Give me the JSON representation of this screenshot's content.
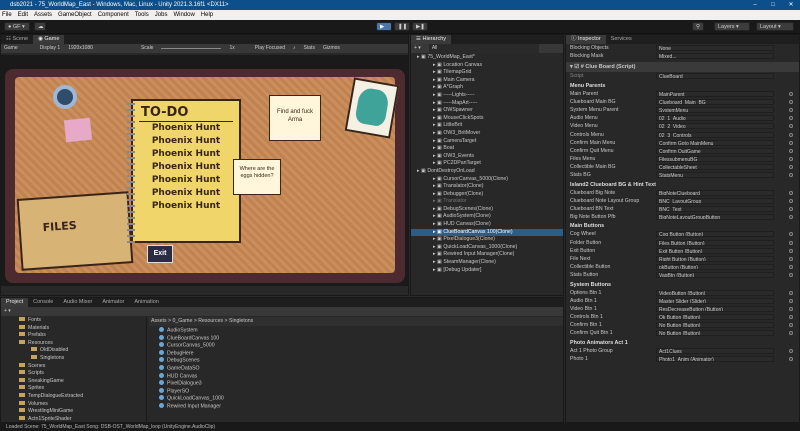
{
  "window": {
    "title": "dsb2021 - 75_WorldMap_East - Windows, Mac, Linux - Unity 2021.3.16f1 <DX11>"
  },
  "menu": [
    "File",
    "Edit",
    "Assets",
    "GameObject",
    "Component",
    "Tools",
    "Jobs",
    "Window",
    "Help"
  ],
  "toolbar": {
    "account": "GF",
    "layers": "Layers",
    "layout": "Layout"
  },
  "scene_tabs": {
    "scene": "Scene",
    "game": "Game"
  },
  "game_bar": {
    "mode": "Game",
    "display": "Display 1",
    "resolution": "1920x1080",
    "scale_label": "Scale",
    "scale_value": "1x",
    "play_focus": "Play Focused",
    "stats": "Stats",
    "gizmos": "Gizmos"
  },
  "game_view": {
    "todo_title": "TO-DO",
    "todo_items": [
      "Phoenix Hunt",
      "Phoenix Hunt",
      "Phoenix Hunt",
      "Phoenix Hunt",
      "Phoenix Hunt",
      "Phoenix Hunt",
      "Phoenix Hunt"
    ],
    "note_find": "Find and fuck Arma",
    "note_eggs": "Where are the eggs hidden?",
    "files_label": "FILES",
    "exit_label": "Exit"
  },
  "hierarchy": {
    "title": "Hierarchy",
    "search": "All",
    "rows": [
      {
        "text": "75_WorldMap_East*",
        "indent": 0,
        "cls": ""
      },
      {
        "text": "Location Canvas",
        "indent": 1,
        "cls": ""
      },
      {
        "text": "TilemapGrid",
        "indent": 1,
        "cls": ""
      },
      {
        "text": "Main Camera",
        "indent": 1,
        "cls": ""
      },
      {
        "text": "A*Graph",
        "indent": 1,
        "cls": ""
      },
      {
        "text": "-----Lights-----",
        "indent": 1,
        "cls": ""
      },
      {
        "text": "-----MapArt-----",
        "indent": 1,
        "cls": ""
      },
      {
        "text": "OWSpawner",
        "indent": 1,
        "cls": ""
      },
      {
        "text": "MouseClickSpots",
        "indent": 1,
        "cls": ""
      },
      {
        "text": "LittleBrit",
        "indent": 1,
        "cls": ""
      },
      {
        "text": "OW3_BritMover",
        "indent": 1,
        "cls": ""
      },
      {
        "text": "CameraTarget",
        "indent": 1,
        "cls": ""
      },
      {
        "text": "Boat",
        "indent": 1,
        "cls": ""
      },
      {
        "text": "OW3_Events",
        "indent": 1,
        "cls": ""
      },
      {
        "text": "PC2DPanTarget",
        "indent": 1,
        "cls": ""
      },
      {
        "text": "DontDestroyOnLoad",
        "indent": 0,
        "cls": ""
      },
      {
        "text": "CursorCanvas_5000(Clone)",
        "indent": 1,
        "cls": ""
      },
      {
        "text": "Translator(Clone)",
        "indent": 1,
        "cls": ""
      },
      {
        "text": "Debugger(Clone)",
        "indent": 1,
        "cls": ""
      },
      {
        "text": "Translator",
        "indent": 1,
        "cls": "dim"
      },
      {
        "text": "DebugScenes(Clone)",
        "indent": 1,
        "cls": ""
      },
      {
        "text": "AudioSystem(Clone)",
        "indent": 1,
        "cls": ""
      },
      {
        "text": "HUD Canvas(Clone)",
        "indent": 1,
        "cls": ""
      },
      {
        "text": "ClueBoardCanvas 100(Clone)",
        "indent": 1,
        "cls": "sel"
      },
      {
        "text": "PixelDialogue3(Clone)",
        "indent": 1,
        "cls": ""
      },
      {
        "text": "QuickLoadCanvas_1000(Clone)",
        "indent": 1,
        "cls": ""
      },
      {
        "text": "Rewired Input Manager(Clone)",
        "indent": 1,
        "cls": ""
      },
      {
        "text": "SteamManager(Clone)",
        "indent": 1,
        "cls": ""
      },
      {
        "text": "[Debug Updater]",
        "indent": 1,
        "cls": ""
      }
    ]
  },
  "inspector": {
    "tabs": [
      "Inspector",
      "Services"
    ],
    "top_rows": [
      {
        "label": "Blocking Objects",
        "value": "None"
      },
      {
        "label": "Blocking Mask",
        "value": "Mixed..."
      }
    ],
    "component": "Clue Board (Script)",
    "script": {
      "label": "Script",
      "value": "ClueBoard"
    },
    "sections": [
      {
        "title": "Menu Parents",
        "rows": [
          {
            "label": "Main Parent",
            "value": "MainParent"
          },
          {
            "label": "Clueboard Main BG",
            "value": "Clueboard_Main_BG"
          },
          {
            "label": "System Menu Parent",
            "value": "SystemMenu"
          },
          {
            "label": "Audio Menu",
            "value": "02_1_Audio"
          },
          {
            "label": "Video Menu",
            "value": "02_2_Video"
          },
          {
            "label": "Controls Menu",
            "value": "02_3_Controls"
          },
          {
            "label": "Confirm Main Menu",
            "value": "Confirm Goto MainMenu"
          },
          {
            "label": "Confirm Quit Menu",
            "value": "Confirm QuitGame"
          },
          {
            "label": "Files Menu",
            "value": "FilessubmenuBG"
          },
          {
            "label": "Collectible Main BG",
            "value": "CollectableSheet"
          },
          {
            "label": "Stats BG",
            "value": "StatsMenu"
          }
        ]
      },
      {
        "title": "Island2 Clueboard BG & Hint Text",
        "rows": [
          {
            "label": "Clueboard Big Note",
            "value": "BigNoteClueboard"
          },
          {
            "label": "Clueboard Note Layout Group",
            "value": "BNC_LayoutGroup"
          },
          {
            "label": "Clueboard BN Text",
            "value": "BNC_Text"
          },
          {
            "label": "Big Note Button Pfb",
            "value": "BigNoteLayoutGroupButton"
          }
        ]
      },
      {
        "title": "Main Buttons",
        "rows": [
          {
            "label": "Cog Wheel",
            "value": "Cog Button (Button)"
          },
          {
            "label": "Folder Button",
            "value": "Files Button (Button)"
          },
          {
            "label": "Exit Button",
            "value": "Exit Button (Button)"
          },
          {
            "label": "File Next",
            "value": "Right Button (Button)"
          },
          {
            "label": "Collectible Button",
            "value": "okButton (Button)"
          },
          {
            "label": "Stats Button",
            "value": "VagBtn (Button)"
          }
        ]
      },
      {
        "title": "System Buttons",
        "rows": [
          {
            "label": "Options Btn 1",
            "value": "VideoButton (Button)"
          },
          {
            "label": "Audio Btn 1",
            "value": "Master Slider (Slider)"
          },
          {
            "label": "Video Btn 1",
            "value": "ResDecreaseButton (Button)"
          },
          {
            "label": "Controls Btn 1",
            "value": "Ok Button (Button)"
          },
          {
            "label": "Confirm Btn 1",
            "value": "No Button (Button)"
          },
          {
            "label": "Confirm Quit Btn 1",
            "value": "No Button (Button)"
          }
        ]
      },
      {
        "title": "Photo Animators Act 1",
        "rows": [
          {
            "label": "Act 1 Photo Group",
            "value": "Act1Clues"
          },
          {
            "label": "Photo 1",
            "value": "Photo1_Anim (Animator)"
          }
        ]
      }
    ]
  },
  "project": {
    "tabs": [
      "Project",
      "Console",
      "Audio Mixer",
      "Animator",
      "Animation"
    ],
    "folders": [
      {
        "name": "Fonts",
        "indent": 1
      },
      {
        "name": "Materials",
        "indent": 1
      },
      {
        "name": "Prefabs",
        "indent": 1
      },
      {
        "name": "Resources",
        "indent": 1
      },
      {
        "name": "OldDisabled",
        "indent": 2
      },
      {
        "name": "Singletons",
        "indent": 2
      },
      {
        "name": "Scenes",
        "indent": 1
      },
      {
        "name": "Scripts",
        "indent": 1
      },
      {
        "name": "SneakingGame",
        "indent": 1
      },
      {
        "name": "Sprites",
        "indent": 1
      },
      {
        "name": "TempDialogueExtracted",
        "indent": 1
      },
      {
        "name": "Volumes",
        "indent": 1
      },
      {
        "name": "WrestlingMiniGame",
        "indent": 1
      },
      {
        "name": "Actn1SpriteShader",
        "indent": 1
      }
    ],
    "breadcrumb": "Assets > 0_Game > Resources > Singletons",
    "assets": [
      "AudioSystem",
      "ClueBoardCanvas 100",
      "CursorCanvas_5000",
      "DebugHere",
      "DebugScenes",
      "GameDataSO",
      "HUD Canvas",
      "PixelDialogue3",
      "PlayerSO",
      "QuickLoadCanvas_1000",
      "Rewired Input Manager"
    ]
  },
  "status": "Loaded Scene: 75_WorldMap_East Song: DSB-OST_WorldMap_loop (UnityEngine.AudioClip)"
}
